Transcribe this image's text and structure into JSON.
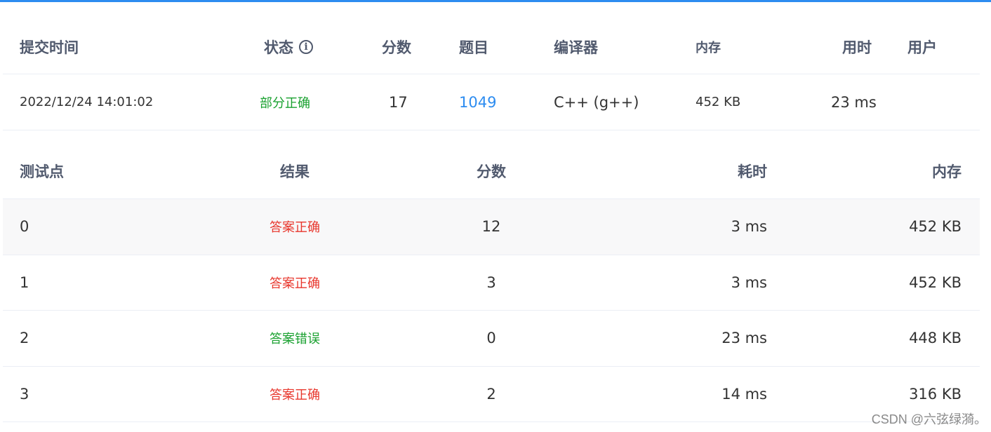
{
  "submission": {
    "headers": {
      "time": "提交时间",
      "status": "状态",
      "score": "分数",
      "problem": "题目",
      "compiler": "编译器",
      "memory": "内存",
      "duration": "用时",
      "user": "用户"
    },
    "row": {
      "time": "2022/12/24 14:01:02",
      "status": "部分正确",
      "score": "17",
      "problem": "1049",
      "compiler": "C++ (g++)",
      "memory": "452 KB",
      "duration": "23 ms",
      "user": ""
    },
    "status_icon": "info-icon",
    "status_icon_glyph": "i"
  },
  "testcases": {
    "headers": {
      "case": "测试点",
      "result": "结果",
      "score": "分数",
      "duration": "耗时",
      "memory": "内存"
    },
    "rows": [
      {
        "case": "0",
        "result": "答案正确",
        "score": "12",
        "duration": "3 ms",
        "memory": "452 KB"
      },
      {
        "case": "1",
        "result": "答案正确",
        "score": "3",
        "duration": "3 ms",
        "memory": "452 KB"
      },
      {
        "case": "2",
        "result": "答案错误",
        "score": "0",
        "duration": "23 ms",
        "memory": "448 KB"
      },
      {
        "case": "3",
        "result": "答案正确",
        "score": "2",
        "duration": "14 ms",
        "memory": "316 KB"
      }
    ]
  },
  "watermark": "CSDN @六弦绿漪。",
  "colors": {
    "accent": "#2d8cf0",
    "correct": "#e8372d",
    "wrong": "#1aa130",
    "partial": "#1aa130"
  }
}
